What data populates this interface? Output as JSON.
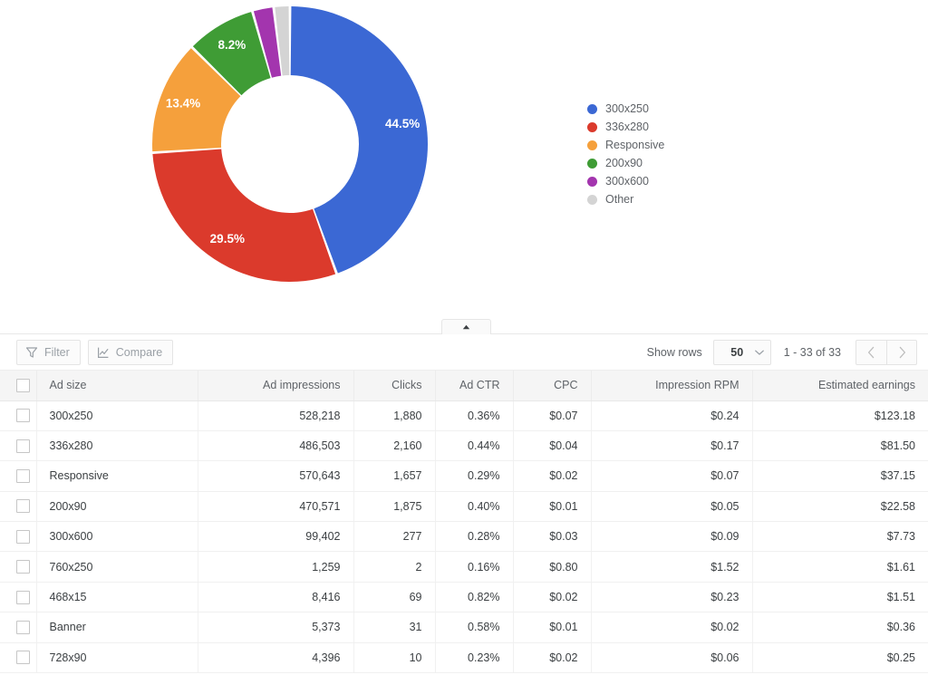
{
  "chart_data": {
    "type": "pie",
    "variant": "donut",
    "title": "",
    "categories": [
      "300x250",
      "336x280",
      "Responsive",
      "200x90",
      "300x600",
      "Other"
    ],
    "values": [
      44.5,
      29.5,
      13.4,
      8.2,
      2.5,
      1.9
    ],
    "value_unit": "%",
    "data_labels": [
      "44.5%",
      "29.5%",
      "13.4%",
      "8.2%",
      "",
      ""
    ],
    "colors": [
      "#3b68d4",
      "#db3a2c",
      "#f5a03c",
      "#3f9c35",
      "#a335ae",
      "#d4d4d4"
    ],
    "legend": {
      "position": "right",
      "entries": [
        {
          "label": "300x250",
          "color": "#3b68d4"
        },
        {
          "label": "336x280",
          "color": "#db3a2c"
        },
        {
          "label": "Responsive",
          "color": "#f5a03c"
        },
        {
          "label": "200x90",
          "color": "#3f9c35"
        },
        {
          "label": "300x600",
          "color": "#a335ae"
        },
        {
          "label": "Other",
          "color": "#d4d4d4"
        }
      ]
    },
    "inner_radius_ratio": 0.5,
    "start_angle_deg": 0,
    "direction": "clockwise"
  },
  "collapse_tab": {
    "icon": "caret-up-icon"
  },
  "toolbar": {
    "filter_label": "Filter",
    "filter_icon": "funnel-icon",
    "compare_label": "Compare",
    "compare_icon": "line-chart-icon",
    "show_rows_label": "Show rows",
    "rows_value": "50",
    "rows_dropdown_icon": "chevron-down-icon",
    "range_text": "1 - 33 of 33",
    "prev_icon": "chevron-left-icon",
    "next_icon": "chevron-right-icon"
  },
  "table": {
    "columns": [
      "Ad size",
      "Ad impressions",
      "Clicks",
      "Ad CTR",
      "CPC",
      "Impression RPM",
      "Estimated earnings"
    ],
    "rows": [
      {
        "ad_size": "300x250",
        "impressions": "528,218",
        "clicks": "1,880",
        "ctr": "0.36%",
        "cpc": "$0.07",
        "rpm": "$0.24",
        "earnings": "$123.18"
      },
      {
        "ad_size": "336x280",
        "impressions": "486,503",
        "clicks": "2,160",
        "ctr": "0.44%",
        "cpc": "$0.04",
        "rpm": "$0.17",
        "earnings": "$81.50"
      },
      {
        "ad_size": "Responsive",
        "impressions": "570,643",
        "clicks": "1,657",
        "ctr": "0.29%",
        "cpc": "$0.02",
        "rpm": "$0.07",
        "earnings": "$37.15"
      },
      {
        "ad_size": "200x90",
        "impressions": "470,571",
        "clicks": "1,875",
        "ctr": "0.40%",
        "cpc": "$0.01",
        "rpm": "$0.05",
        "earnings": "$22.58"
      },
      {
        "ad_size": "300x600",
        "impressions": "99,402",
        "clicks": "277",
        "ctr": "0.28%",
        "cpc": "$0.03",
        "rpm": "$0.09",
        "earnings": "$7.73"
      },
      {
        "ad_size": "760x250",
        "impressions": "1,259",
        "clicks": "2",
        "ctr": "0.16%",
        "cpc": "$0.80",
        "rpm": "$1.52",
        "earnings": "$1.61"
      },
      {
        "ad_size": "468x15",
        "impressions": "8,416",
        "clicks": "69",
        "ctr": "0.82%",
        "cpc": "$0.02",
        "rpm": "$0.23",
        "earnings": "$1.51"
      },
      {
        "ad_size": "Banner",
        "impressions": "5,373",
        "clicks": "31",
        "ctr": "0.58%",
        "cpc": "$0.01",
        "rpm": "$0.02",
        "earnings": "$0.36"
      },
      {
        "ad_size": "728x90",
        "impressions": "4,396",
        "clicks": "10",
        "ctr": "0.23%",
        "cpc": "$0.02",
        "rpm": "$0.06",
        "earnings": "$0.25"
      }
    ]
  }
}
